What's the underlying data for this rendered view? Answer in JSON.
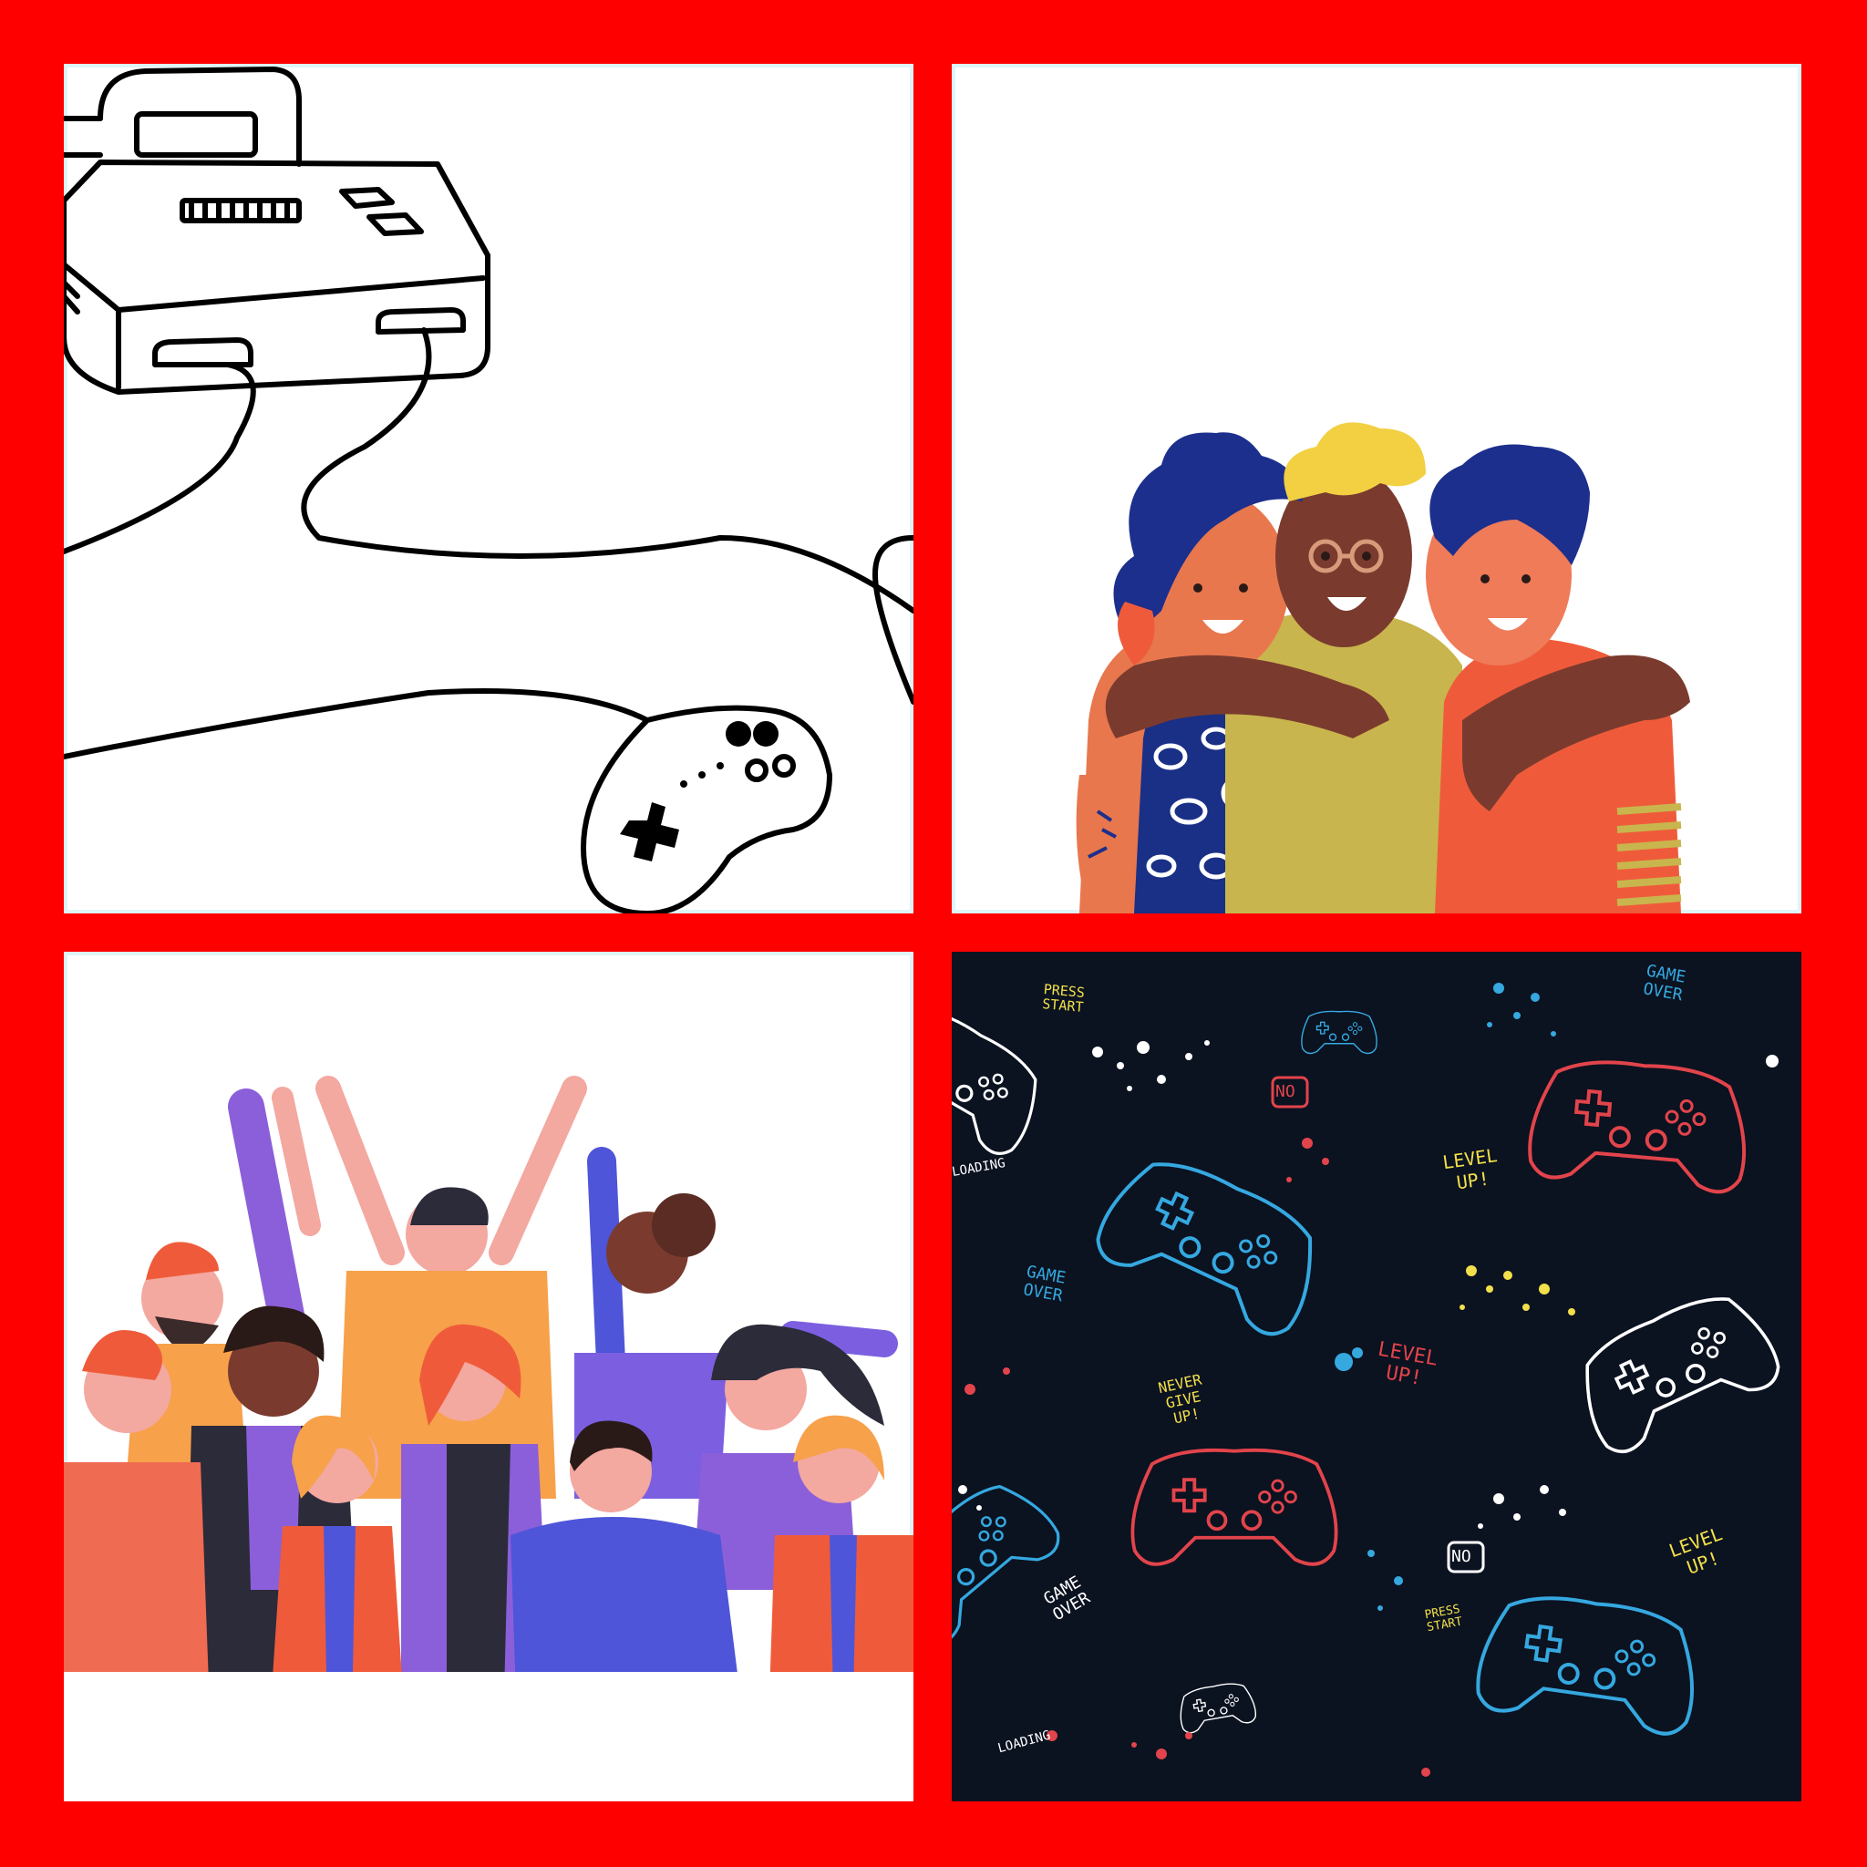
{
  "background_color": "#ff0000",
  "panels": {
    "console": {
      "illustration": "retro-console-with-gamepad-line-drawing"
    },
    "friends": {
      "illustration": "three-friends-hugging"
    },
    "crowd": {
      "illustration": "cheering-crowd"
    },
    "pattern": {
      "illustration": "gamepad-pattern-dark",
      "texts": {
        "press_start_1": "PRESS\nSTART",
        "game_over_1": "GAME\nOVER",
        "no_1": "NO",
        "loading_1": "LOADING",
        "level_up_1": "LEVEL\nUP!",
        "game_over_2": "GAME\nOVER",
        "level_up_2": "LEVEL\nUP!",
        "never_give_up": "NEVER\nGIVE\nUP!",
        "no_2": "NO",
        "level_up_3": "LEVEL\nUP!",
        "game_over_3": "GAME\nOVER",
        "press_start_2": "PRESS\nSTART",
        "loading_2": "LOADING"
      }
    }
  }
}
